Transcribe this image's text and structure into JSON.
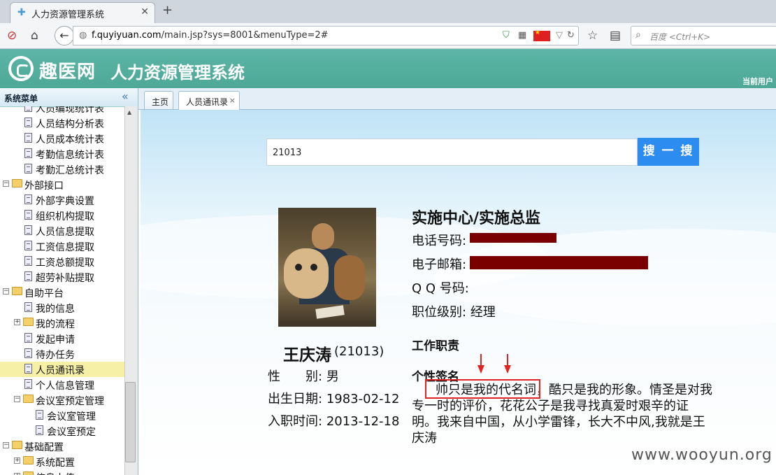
{
  "browser": {
    "tab_title": "人力资源管理系统",
    "url_domain": "f.quyiyuan.com",
    "url_path": "/main.jsp?sys=8001&menuType=2#",
    "search_placeholder": "百度 <Ctrl+K>"
  },
  "header": {
    "brand": "趣医网",
    "system_title": "人力资源管理系统",
    "current_user_label": "当前用户"
  },
  "sidebar": {
    "title": "系统菜单",
    "collapse_glyph": "«",
    "items": [
      {
        "label": "人员编现统计表",
        "type": "page",
        "level": 2
      },
      {
        "label": "人员结构分析表",
        "type": "page",
        "level": 2
      },
      {
        "label": "人员成本统计表",
        "type": "page",
        "level": 2
      },
      {
        "label": "考勤信息统计表",
        "type": "page",
        "level": 2
      },
      {
        "label": "考勤汇总统计表",
        "type": "page",
        "level": 2
      },
      {
        "label": "外部接口",
        "type": "folder",
        "level": 1,
        "expanded": true
      },
      {
        "label": "外部字典设置",
        "type": "page",
        "level": 2
      },
      {
        "label": "组织机构提取",
        "type": "page",
        "level": 2
      },
      {
        "label": "人员信息提取",
        "type": "page",
        "level": 2
      },
      {
        "label": "工资信息提取",
        "type": "page",
        "level": 2
      },
      {
        "label": "工资总额提取",
        "type": "page",
        "level": 2
      },
      {
        "label": "超劳补贴提取",
        "type": "page",
        "level": 2
      },
      {
        "label": "自助平台",
        "type": "folder",
        "level": 1,
        "expanded": true
      },
      {
        "label": "我的信息",
        "type": "page",
        "level": 2
      },
      {
        "label": "我的流程",
        "type": "folder",
        "level": 2,
        "expanded": false
      },
      {
        "label": "发起申请",
        "type": "page",
        "level": 2
      },
      {
        "label": "待办任务",
        "type": "page",
        "level": 2
      },
      {
        "label": "人员通讯录",
        "type": "page",
        "level": 2,
        "selected": true
      },
      {
        "label": "个人信息管理",
        "type": "page",
        "level": 2
      },
      {
        "label": "会议室预定管理",
        "type": "folder",
        "level": 2,
        "expanded": true
      },
      {
        "label": "会议室管理",
        "type": "page",
        "level": 3
      },
      {
        "label": "会议室预定",
        "type": "page",
        "level": 3
      },
      {
        "label": "基础配置",
        "type": "folder",
        "level": 1,
        "expanded": true
      },
      {
        "label": "系统配置",
        "type": "folder",
        "level": 2,
        "expanded": false
      },
      {
        "label": "信息上传",
        "type": "folder",
        "level": 2,
        "expanded": false
      }
    ]
  },
  "tabs": [
    {
      "label": "主页",
      "closable": false
    },
    {
      "label": "人员通讯录",
      "closable": true,
      "active": true
    }
  ],
  "search": {
    "value": "21013",
    "button_label": "搜 一 搜"
  },
  "profile": {
    "name": "王庆涛",
    "id_display": "(21013)",
    "gender_label": "性　　别:",
    "gender": "男",
    "birth_label": "出生日期:",
    "birth": "1983-02-12",
    "hire_label": "入职时间:",
    "hire": "2013-12-18",
    "title": "实施中心/实施总监",
    "phone_label": "电话号码:",
    "email_label": "电子邮箱:",
    "qq_label": "Q Q 号码:",
    "level_label": "职位级别:",
    "level": "经理",
    "duty_label": "工作职责",
    "signature_label": "个性签名",
    "signature": "帅只是我的代名词，酷只是我的形象。情圣是对我专一时的评价，花花公子是我寻找真爱时艰辛的证明。我来自中国，从小学雷锋，长大不中风,我就是王庆涛"
  },
  "watermark": "www.wooyun.org",
  "colors": {
    "header_bg": "#55ae9e",
    "search_button": "#2d8cf0",
    "selected_item": "#f6f0a6",
    "annotation_red": "#e02424",
    "redaction": "#7a0000"
  }
}
